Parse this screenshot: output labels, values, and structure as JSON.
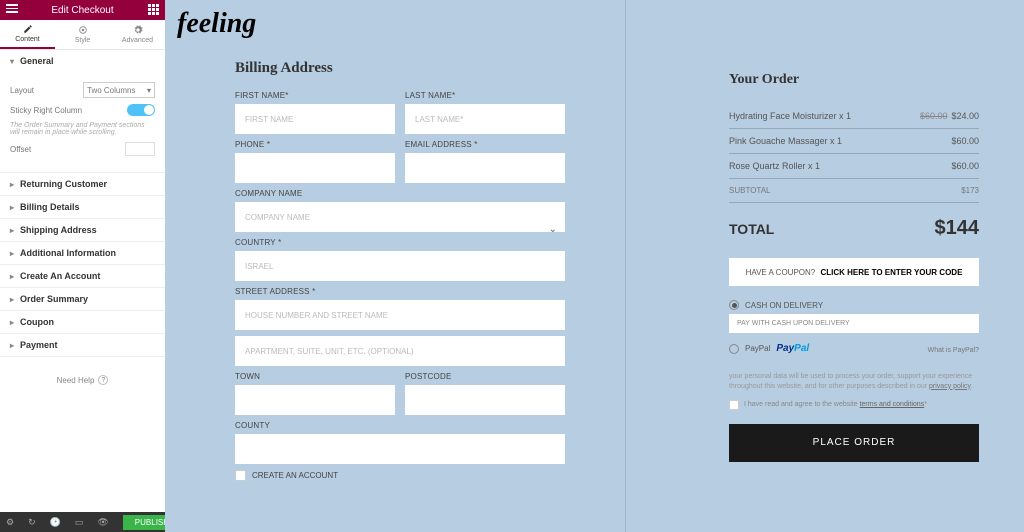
{
  "panel": {
    "title": "Edit Checkout",
    "tabs": {
      "content": "Content",
      "style": "Style",
      "advanced": "Advanced"
    },
    "general": {
      "title": "General",
      "layout_label": "Layout",
      "layout_value": "Two Columns",
      "sticky_label": "Sticky Right Column",
      "sticky_on": "Yes",
      "sticky_note": "The Order Summary and Payment sections will remain in place while scrolling.",
      "offset_label": "Offset"
    },
    "sections": [
      "Returning Customer",
      "Billing Details",
      "Shipping Address",
      "Additional Information",
      "Create An Account",
      "Order Summary",
      "Coupon",
      "Payment"
    ],
    "help": "Need Help",
    "publish": "PUBLISH"
  },
  "logo": "feeling",
  "billing": {
    "heading": "Billing Address",
    "first_name": "FIRST NAME*",
    "first_name_ph": "FIRST NAME",
    "last_name": "LAST NAME*",
    "last_name_ph": "LAST NAME*",
    "phone": "PHONE *",
    "email": "EMAIL ADDRESS *",
    "company": "COMPANY NAME",
    "company_ph": "COMPANY NAME",
    "country": "COUNTRY *",
    "country_val": "ISRAEL",
    "street": "STREET ADDRESS *",
    "street_ph1": "HOUSE NUMBER AND STREET NAME",
    "street_ph2": "APARTMENT, SUITE, UNIT, ETC. (OPTIONAL)",
    "town": "TOWN",
    "postcode": "POSTCODE",
    "county": "COUNTY",
    "create_account": "CREATE AN ACCOUNT"
  },
  "order": {
    "heading": "Your Order",
    "lines": [
      {
        "name": "Hydrating Face Moisturizer x 1",
        "strike": "$60.00",
        "price": "$24.00"
      },
      {
        "name": "Pink Gouache Massager x 1",
        "price": "$60.00"
      },
      {
        "name": "Rose Quartz Roller x 1",
        "price": "$60.00"
      }
    ],
    "subtotal_label": "SUBTOTAL",
    "subtotal": "$173",
    "total_label": "TOTAL",
    "total": "$144",
    "coupon_q": "HAVE A COUPON?",
    "coupon_a": "CLICK HERE TO ENTER YOUR CODE",
    "cod": "CASH ON DELIVERY",
    "cod_note": "PAY WITH CASH UPON DELIVERY",
    "paypal": "PayPal",
    "what_paypal": "What is PayPal?",
    "privacy": "your personal data will be used to process your order, support your experience throughout this website, and for other purposes described in our ",
    "privacy_link": "privacy policy",
    "terms_pre": "I have read and agree to the website ",
    "terms_link": "terms and conditions",
    "terms_post": "*",
    "place": "PLACE ORDER"
  }
}
